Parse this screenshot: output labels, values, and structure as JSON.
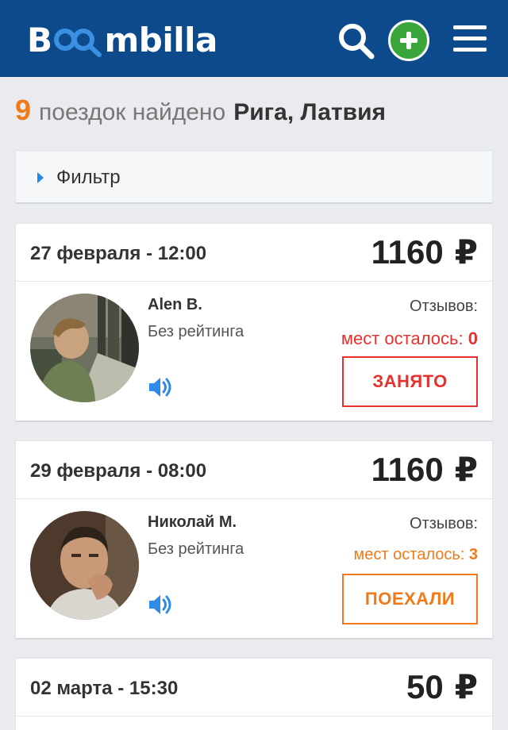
{
  "header": {
    "logo_prefix": "B",
    "logo_suffix": "mbilla",
    "colors": {
      "bar": "#0c4a8c",
      "logo_accent": "#3b8fe0",
      "add_button": "#3aa53a"
    },
    "icons": [
      "search-icon",
      "add-trip-icon",
      "menu-icon"
    ]
  },
  "results": {
    "count": "9",
    "text": "поездок найдено",
    "city": "Рига, Латвия"
  },
  "filter": {
    "label": "Фильтр"
  },
  "colors": {
    "accent_orange": "#f07a1a",
    "busy_red": "#e5322d"
  },
  "trips": [
    {
      "date": "27 февраля - 12:00",
      "price": "1160",
      "currency": "₽",
      "driver_name": "Alen B.",
      "rating": "Без рейтинга",
      "reviews_label": "Отзывов:",
      "seats_label": "мест осталось:",
      "seats_count": "0",
      "button": "ЗАНЯТО",
      "status_color": "#e5322d"
    },
    {
      "date": "29 февраля - 08:00",
      "price": "1160",
      "currency": "₽",
      "driver_name": "Николай М.",
      "rating": "Без рейтинга",
      "reviews_label": "Отзывов:",
      "seats_label": "мест осталось:",
      "seats_count": "3",
      "button": "ПОЕХАЛИ",
      "status_color": "#f07a1a"
    },
    {
      "date": "02 марта - 15:30",
      "price": "50",
      "currency": "₽"
    }
  ]
}
